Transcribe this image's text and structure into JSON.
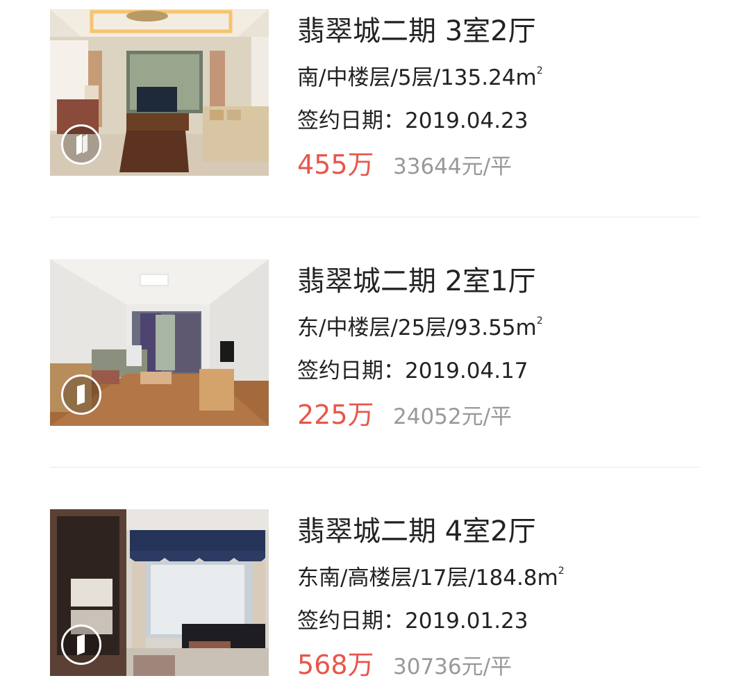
{
  "listings": [
    {
      "title": "翡翠城二期 3室2厅",
      "info": "南/中楼层/5层/135.24m",
      "info_suffix": "2",
      "date": "签约日期：2019.04.23",
      "price": "455万",
      "unit_price": "33644元/平"
    },
    {
      "title": "翡翠城二期 2室1厅",
      "info": "东/中楼层/25层/93.55m",
      "info_suffix": "2",
      "date": "签约日期：2019.04.17",
      "price": "225万",
      "unit_price": "24052元/平"
    },
    {
      "title": "翡翠城二期 4室2厅",
      "info": "东南/高楼层/17层/184.8m",
      "info_suffix": "2",
      "date": "签约日期：2019.01.23",
      "price": "568万",
      "unit_price": "30736元/平"
    }
  ],
  "icons": {
    "vr_badge": "vr-tour-icon"
  },
  "colors": {
    "price": "#e8564a",
    "unit_price": "#999999",
    "text": "#222222",
    "divider": "#e8e8e8"
  }
}
